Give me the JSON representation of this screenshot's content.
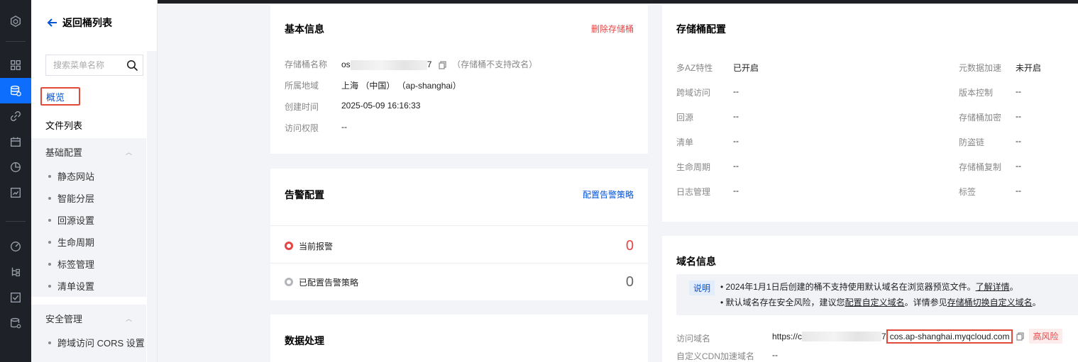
{
  "sidebar": {
    "back_label": "返回桶列表",
    "search_placeholder": "搜索菜单名称",
    "overview": "概览",
    "files": "文件列表",
    "group_basic": "基础配置",
    "basic_items": [
      "静态网站",
      "智能分层",
      "回源设置",
      "生命周期",
      "标签管理",
      "清单设置"
    ],
    "group_security": "安全管理",
    "security_items": [
      "跨域访问 CORS 设置"
    ]
  },
  "basic_info": {
    "title": "基本信息",
    "delete_label": "删除存储桶",
    "rows": {
      "name_k": "存储桶名称",
      "name_prefix": "os",
      "name_suffix": "7",
      "name_note": "（存储桶不支持改名）",
      "region_k": "所属地域",
      "region_v": "上海 （中国） （ap-shanghai）",
      "created_k": "创建时间",
      "created_v": "2025-05-09 16:16:33",
      "access_k": "访问权限",
      "access_v": "--"
    }
  },
  "alert": {
    "title": "告警配置",
    "config_link": "配置告警策略",
    "current_label": "当前报警",
    "current_count": "0",
    "configured_label": "已配置告警策略",
    "configured_count": "0"
  },
  "data_proc": {
    "title": "数据处理"
  },
  "bucket_config": {
    "title": "存储桶配置",
    "left": [
      {
        "k": "多AZ特性",
        "v": "已开启"
      },
      {
        "k": "跨域访问",
        "v": "--"
      },
      {
        "k": "回源",
        "v": "--"
      },
      {
        "k": "清单",
        "v": "--"
      },
      {
        "k": "生命周期",
        "v": "--"
      },
      {
        "k": "日志管理",
        "v": "--"
      }
    ],
    "right": [
      {
        "k": "元数据加速",
        "v": "未开启"
      },
      {
        "k": "版本控制",
        "v": "--"
      },
      {
        "k": "存储桶加密",
        "v": "--"
      },
      {
        "k": "防盗链",
        "v": "--"
      },
      {
        "k": "存储桶复制",
        "v": "--"
      },
      {
        "k": "标签",
        "v": "--"
      }
    ]
  },
  "domain": {
    "title": "域名信息",
    "note_tag": "说明",
    "note1_text": "2024年1月1日后创建的桶不支持使用默认域名在浏览器预览文件。",
    "note1_link": "了解详情",
    "note1_end": "。",
    "note2_text": "默认域名存在安全风险，建议您",
    "note2_link1": "配置自定义域名",
    "note2_mid": "。详情参见",
    "note2_link2": "存储桶切换自定义域名",
    "note2_end": "。",
    "access_k": "访问域名",
    "access_prefix": "https://c",
    "access_mid": "7",
    "access_suffix": "cos.ap-shanghai.myqcloud.com",
    "risk": "高风险",
    "cdn_k": "自定义CDN加速域名",
    "cdn_v": "--"
  }
}
